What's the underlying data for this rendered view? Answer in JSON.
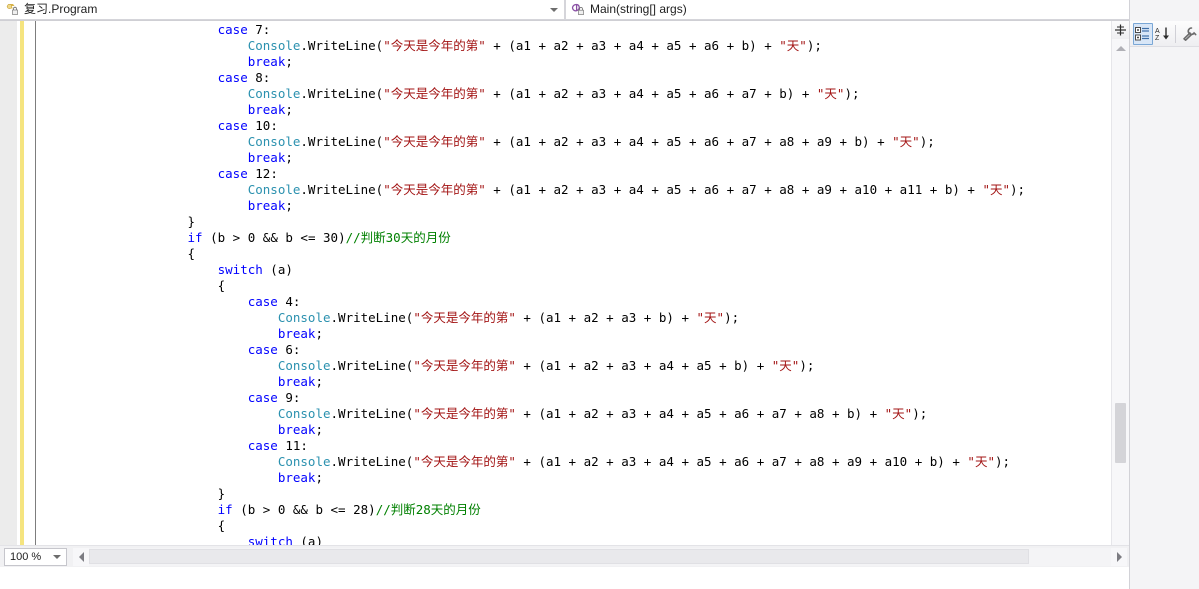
{
  "navbar": {
    "type_dropdown": {
      "label": "复习.Program",
      "icon": "class-icon",
      "dropdown_icon": "chevron-down-icon"
    },
    "member_dropdown": {
      "label": "Main(string[] args)",
      "icon": "method-icon",
      "dropdown_icon": "chevron-down-icon"
    }
  },
  "properties_toolbar": {
    "categorized_label": "categorized-view",
    "alphabetical_label": "alphabetical-sort",
    "properties_label": "properties-page"
  },
  "statusbar": {
    "zoom": "100 %",
    "zoom_dropdown": "chevron-down-icon"
  },
  "editor": {
    "language": "csharp",
    "lines": [
      {
        "indent": 24,
        "tokens": [
          {
            "t": "case ",
            "c": "kw"
          },
          {
            "t": "7",
            "c": "num"
          },
          {
            "t": ":",
            "c": "pl"
          }
        ]
      },
      {
        "indent": 28,
        "tokens": [
          {
            "t": "Console",
            "c": "type"
          },
          {
            "t": ".WriteLine(",
            "c": "pl"
          },
          {
            "t": "\"今天是今年的第\"",
            "c": "str"
          },
          {
            "t": " + (a1 + a2 + a3 + a4 + a5 + a6 + b) + ",
            "c": "pl"
          },
          {
            "t": "\"天\"",
            "c": "str"
          },
          {
            "t": ");",
            "c": "pl"
          }
        ]
      },
      {
        "indent": 28,
        "tokens": [
          {
            "t": "break",
            "c": "kw"
          },
          {
            "t": ";",
            "c": "pl"
          }
        ]
      },
      {
        "indent": 24,
        "tokens": [
          {
            "t": "case ",
            "c": "kw"
          },
          {
            "t": "8",
            "c": "num"
          },
          {
            "t": ":",
            "c": "pl"
          }
        ]
      },
      {
        "indent": 28,
        "tokens": [
          {
            "t": "Console",
            "c": "type"
          },
          {
            "t": ".WriteLine(",
            "c": "pl"
          },
          {
            "t": "\"今天是今年的第\"",
            "c": "str"
          },
          {
            "t": " + (a1 + a2 + a3 + a4 + a5 + a6 + a7 + b) + ",
            "c": "pl"
          },
          {
            "t": "\"天\"",
            "c": "str"
          },
          {
            "t": ");",
            "c": "pl"
          }
        ]
      },
      {
        "indent": 28,
        "tokens": [
          {
            "t": "break",
            "c": "kw"
          },
          {
            "t": ";",
            "c": "pl"
          }
        ]
      },
      {
        "indent": 24,
        "tokens": [
          {
            "t": "case ",
            "c": "kw"
          },
          {
            "t": "10",
            "c": "num"
          },
          {
            "t": ":",
            "c": "pl"
          }
        ]
      },
      {
        "indent": 28,
        "tokens": [
          {
            "t": "Console",
            "c": "type"
          },
          {
            "t": ".WriteLine(",
            "c": "pl"
          },
          {
            "t": "\"今天是今年的第\"",
            "c": "str"
          },
          {
            "t": " + (a1 + a2 + a3 + a4 + a5 + a6 + a7 + a8 + a9 + b) + ",
            "c": "pl"
          },
          {
            "t": "\"天\"",
            "c": "str"
          },
          {
            "t": ");",
            "c": "pl"
          }
        ]
      },
      {
        "indent": 28,
        "tokens": [
          {
            "t": "break",
            "c": "kw"
          },
          {
            "t": ";",
            "c": "pl"
          }
        ]
      },
      {
        "indent": 24,
        "tokens": [
          {
            "t": "case ",
            "c": "kw"
          },
          {
            "t": "12",
            "c": "num"
          },
          {
            "t": ":",
            "c": "pl"
          }
        ]
      },
      {
        "indent": 28,
        "tokens": [
          {
            "t": "Console",
            "c": "type"
          },
          {
            "t": ".WriteLine(",
            "c": "pl"
          },
          {
            "t": "\"今天是今年的第\"",
            "c": "str"
          },
          {
            "t": " + (a1 + a2 + a3 + a4 + a5 + a6 + a7 + a8 + a9 + a10 + a11 + b) + ",
            "c": "pl"
          },
          {
            "t": "\"天\"",
            "c": "str"
          },
          {
            "t": ");",
            "c": "pl"
          }
        ]
      },
      {
        "indent": 28,
        "tokens": [
          {
            "t": "break",
            "c": "kw"
          },
          {
            "t": ";",
            "c": "pl"
          }
        ]
      },
      {
        "indent": 20,
        "tokens": [
          {
            "t": "}",
            "c": "pl"
          }
        ]
      },
      {
        "indent": 20,
        "tokens": [
          {
            "t": "if",
            "c": "kw"
          },
          {
            "t": " (b > ",
            "c": "pl"
          },
          {
            "t": "0",
            "c": "num"
          },
          {
            "t": " && b <= ",
            "c": "pl"
          },
          {
            "t": "30",
            "c": "num"
          },
          {
            "t": ")",
            "c": "pl"
          },
          {
            "t": "//判断30天的月份",
            "c": "cmt"
          }
        ]
      },
      {
        "indent": 20,
        "tokens": [
          {
            "t": "{",
            "c": "pl"
          }
        ]
      },
      {
        "indent": 24,
        "tokens": [
          {
            "t": "switch",
            "c": "kw"
          },
          {
            "t": " (a)",
            "c": "pl"
          }
        ]
      },
      {
        "indent": 24,
        "tokens": [
          {
            "t": "{",
            "c": "pl"
          }
        ]
      },
      {
        "indent": 28,
        "tokens": [
          {
            "t": "case ",
            "c": "kw"
          },
          {
            "t": "4",
            "c": "num"
          },
          {
            "t": ":",
            "c": "pl"
          }
        ]
      },
      {
        "indent": 32,
        "tokens": [
          {
            "t": "Console",
            "c": "type"
          },
          {
            "t": ".WriteLine(",
            "c": "pl"
          },
          {
            "t": "\"今天是今年的第\"",
            "c": "str"
          },
          {
            "t": " + (a1 + a2 + a3 + b) + ",
            "c": "pl"
          },
          {
            "t": "\"天\"",
            "c": "str"
          },
          {
            "t": ");",
            "c": "pl"
          }
        ]
      },
      {
        "indent": 32,
        "tokens": [
          {
            "t": "break",
            "c": "kw"
          },
          {
            "t": ";",
            "c": "pl"
          }
        ]
      },
      {
        "indent": 28,
        "tokens": [
          {
            "t": "case ",
            "c": "kw"
          },
          {
            "t": "6",
            "c": "num"
          },
          {
            "t": ":",
            "c": "pl"
          }
        ]
      },
      {
        "indent": 32,
        "tokens": [
          {
            "t": "Console",
            "c": "type"
          },
          {
            "t": ".WriteLine(",
            "c": "pl"
          },
          {
            "t": "\"今天是今年的第\"",
            "c": "str"
          },
          {
            "t": " + (a1 + a2 + a3 + a4 + a5 + b) + ",
            "c": "pl"
          },
          {
            "t": "\"天\"",
            "c": "str"
          },
          {
            "t": ");",
            "c": "pl"
          }
        ]
      },
      {
        "indent": 32,
        "tokens": [
          {
            "t": "break",
            "c": "kw"
          },
          {
            "t": ";",
            "c": "pl"
          }
        ]
      },
      {
        "indent": 28,
        "tokens": [
          {
            "t": "case ",
            "c": "kw"
          },
          {
            "t": "9",
            "c": "num"
          },
          {
            "t": ":",
            "c": "pl"
          }
        ]
      },
      {
        "indent": 32,
        "tokens": [
          {
            "t": "Console",
            "c": "type"
          },
          {
            "t": ".WriteLine(",
            "c": "pl"
          },
          {
            "t": "\"今天是今年的第\"",
            "c": "str"
          },
          {
            "t": " + (a1 + a2 + a3 + a4 + a5 + a6 + a7 + a8 + b) + ",
            "c": "pl"
          },
          {
            "t": "\"天\"",
            "c": "str"
          },
          {
            "t": ");",
            "c": "pl"
          }
        ]
      },
      {
        "indent": 32,
        "tokens": [
          {
            "t": "break",
            "c": "kw"
          },
          {
            "t": ";",
            "c": "pl"
          }
        ]
      },
      {
        "indent": 28,
        "tokens": [
          {
            "t": "case ",
            "c": "kw"
          },
          {
            "t": "11",
            "c": "num"
          },
          {
            "t": ":",
            "c": "pl"
          }
        ]
      },
      {
        "indent": 32,
        "tokens": [
          {
            "t": "Console",
            "c": "type"
          },
          {
            "t": ".WriteLine(",
            "c": "pl"
          },
          {
            "t": "\"今天是今年的第\"",
            "c": "str"
          },
          {
            "t": " + (a1 + a2 + a3 + a4 + a5 + a6 + a7 + a8 + a9 + a10 + b) + ",
            "c": "pl"
          },
          {
            "t": "\"天\"",
            "c": "str"
          },
          {
            "t": ");",
            "c": "pl"
          }
        ]
      },
      {
        "indent": 32,
        "tokens": [
          {
            "t": "break",
            "c": "kw"
          },
          {
            "t": ";",
            "c": "pl"
          }
        ]
      },
      {
        "indent": 24,
        "tokens": [
          {
            "t": "}",
            "c": "pl"
          }
        ]
      },
      {
        "indent": 24,
        "tokens": [
          {
            "t": "if",
            "c": "kw"
          },
          {
            "t": " (b > ",
            "c": "pl"
          },
          {
            "t": "0",
            "c": "num"
          },
          {
            "t": " && b <= ",
            "c": "pl"
          },
          {
            "t": "28",
            "c": "num"
          },
          {
            "t": ")",
            "c": "pl"
          },
          {
            "t": "//判断28天的月份",
            "c": "cmt"
          }
        ]
      },
      {
        "indent": 24,
        "tokens": [
          {
            "t": "{",
            "c": "pl"
          }
        ]
      },
      {
        "indent": 28,
        "tokens": [
          {
            "t": "switch",
            "c": "kw"
          },
          {
            "t": " (a)",
            "c": "pl"
          }
        ]
      },
      {
        "indent": 28,
        "tokens": [
          {
            "t": "{",
            "c": "pl"
          }
        ]
      }
    ]
  },
  "colors": {
    "keyword": "#0000ff",
    "type": "#2b91af",
    "string": "#a31515",
    "comment": "#008000",
    "plain": "#000000",
    "change_bar": "#f5e47f",
    "accent": "#d8e6f7"
  }
}
